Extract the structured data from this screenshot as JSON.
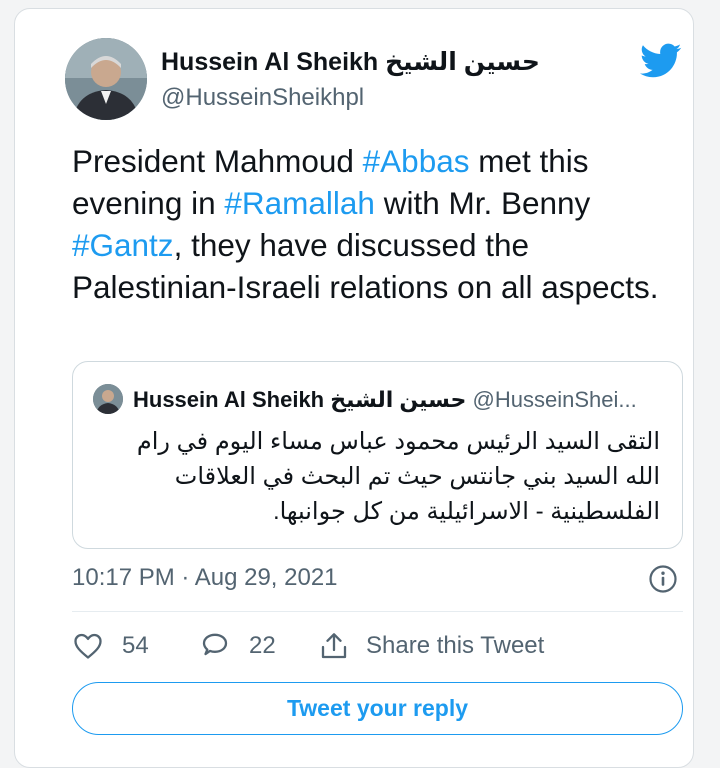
{
  "author": {
    "display_name": "Hussein Al Sheikh حسين الشيخ",
    "handle": "@HusseinSheikhpl"
  },
  "tweet": {
    "segments": [
      {
        "text": "President Mahmoud ",
        "hashtag": false
      },
      {
        "text": "#Abbas",
        "hashtag": true
      },
      {
        "text": " met this evening in ",
        "hashtag": false
      },
      {
        "text": "#Ramallah",
        "hashtag": true
      },
      {
        "text": " with Mr. Benny ",
        "hashtag": false
      },
      {
        "text": "#Gantz",
        "hashtag": true
      },
      {
        "text": ", they have discussed the Palestinian-Israeli relations on all aspects.",
        "hashtag": false
      }
    ]
  },
  "quoted_tweet": {
    "display_name": "Hussein Al Sheikh حسين الشيخ",
    "handle": "@HusseinShei...",
    "text": "التقى السيد الرئيس محمود عباس مساء اليوم في رام الله السيد بني جانتس حيث تم البحث في العلاقات الفلسطينية - الاسرائيلية من كل جوانبها."
  },
  "meta": {
    "timestamp": "10:17 PM · Aug 29, 2021"
  },
  "actions": {
    "likes": "54",
    "replies": "22",
    "share_label": "Share this Tweet"
  },
  "reply_button": {
    "label": "Tweet your reply"
  },
  "icons": {
    "brand": "twitter-bird-icon",
    "info": "info-icon",
    "like": "heart-icon",
    "reply": "comment-icon",
    "share": "share-icon"
  },
  "colors": {
    "accent": "#1d9bf0",
    "text": "#0f1419",
    "secondary": "#536471",
    "border": "#cfd9de"
  }
}
